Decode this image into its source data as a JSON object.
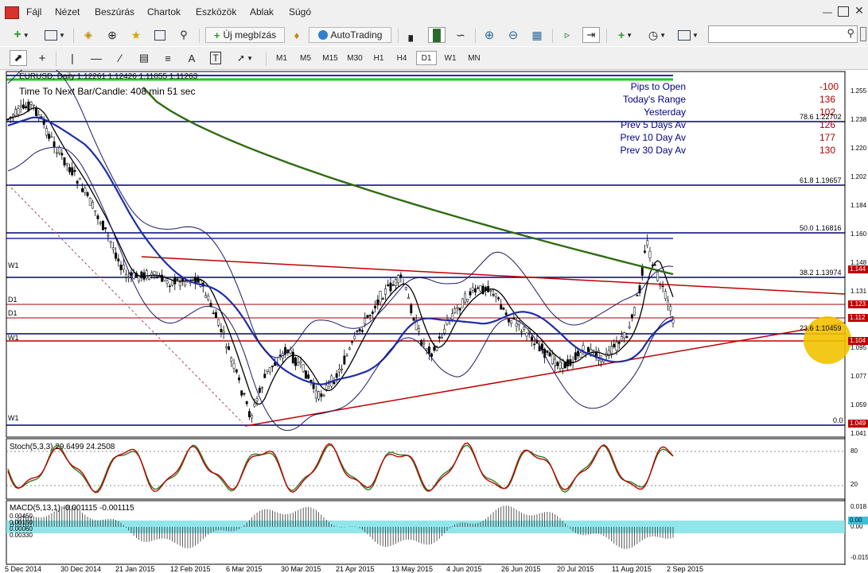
{
  "menu": {
    "items": [
      "Fájl",
      "Nézet",
      "Beszúrás",
      "Chartok",
      "Eszközök",
      "Ablak",
      "Súgó"
    ]
  },
  "toolbar": {
    "new_order_label": "Új megbízás",
    "autotrading_label": "AutoTrading",
    "search_value": ""
  },
  "timeframes": [
    "M1",
    "M5",
    "M15",
    "M30",
    "H1",
    "H4",
    "D1",
    "W1",
    "MN"
  ],
  "active_timeframe": "D1",
  "chart": {
    "title": "EURUSD, Daily  1.12261 1.12426 1.11055 1.11263",
    "timer": "Time To Next Bar/Candle: 408 min 51 sec",
    "stats": [
      {
        "label": "Pips to Open",
        "value": "-100"
      },
      {
        "label": "Today's Range",
        "value": "136"
      },
      {
        "label": "Yesterday",
        "value": "102"
      },
      {
        "label": "Prev 5 Days Av",
        "value": "126"
      },
      {
        "label": "Prev 10 Day Av",
        "value": "177"
      },
      {
        "label": "Prev 30 Day Av",
        "value": "130"
      }
    ],
    "fib_labels": [
      "78.6 1.22702",
      "61.8 1.19657",
      "50.0 1.16816",
      "38.2 1.13974",
      "23.6 1.10459",
      "0.0"
    ],
    "level_labels": [
      "W1",
      "D1",
      "D1",
      "W1",
      "W1"
    ],
    "price_axis": [
      "1.255",
      "1.238",
      "1.220",
      "1.202",
      "1.184",
      "1.160",
      "1.148",
      "1.131",
      "1.095",
      "1.077",
      "1.059",
      "1.041"
    ],
    "price_boxes": [
      "1.144",
      "1.123",
      "1.112",
      "1.104",
      "1.049"
    ],
    "stoch_title": "Stoch(5,3,3) 29.6499 24.2508",
    "stoch_levels": [
      "80",
      "20"
    ],
    "macd_title": "MACD(5,13,1) -0.001115 -0.001115",
    "macd_axis": [
      "0.018",
      "0.00",
      "-0.015"
    ],
    "macd_box": "0.00",
    "macd_left_labels": [
      "0.00450",
      "0.00150",
      "0.00060",
      "0.00330"
    ],
    "dates": [
      "5 Dec 2014",
      "30 Dec 2014",
      "21 Jan 2015",
      "12 Feb 2015",
      "6 Mar 2015",
      "30 Mar 2015",
      "21 Apr 2015",
      "13 May 2015",
      "4 Jun 2015",
      "26 Jun 2015",
      "20 Jul 2015",
      "11 Aug 2015",
      "2 Sep 2015"
    ],
    "colors": {
      "candle": "#000000",
      "ma_fast": "#000000",
      "ma_mid": "#1e2da8",
      "ma_slow": "#2e6b12",
      "level_line": "#000080",
      "trend_line": "#c00000",
      "stoch_main": "#2e7d1e",
      "stoch_signal": "#c00000",
      "macd_band": "#7fe0e8"
    }
  }
}
